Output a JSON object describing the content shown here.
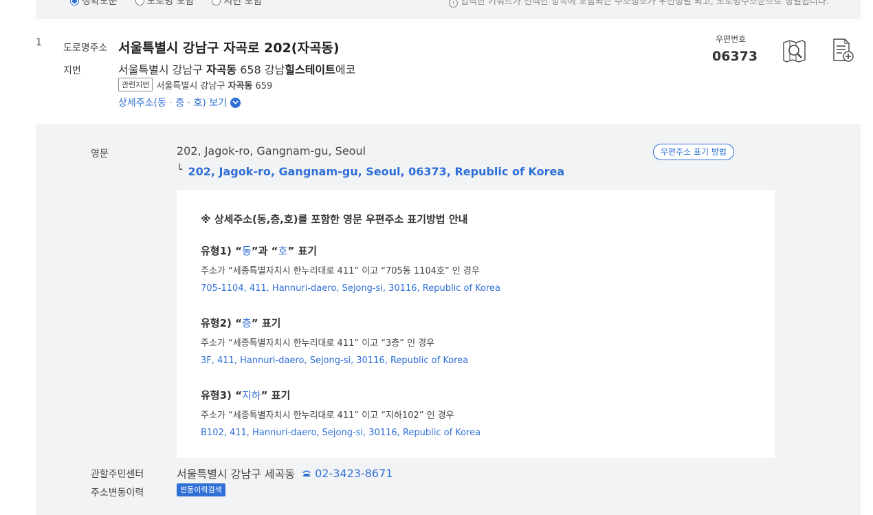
{
  "filter": {
    "options": [
      "정확도순",
      "도로명 포함",
      "지번 포함"
    ],
    "selected_index": 0,
    "hint": "입력한 키워드가 선택한 항목에 포함되는 주소정보가 우선정렬 되고, 도로명주소순으로 정렬됩니다."
  },
  "result": {
    "index": "1",
    "road_label": "도로명주소",
    "road_address": "서울특별시 강남구 자곡로 202(자곡동)",
    "jibun_label": "지번",
    "jibun_pre": "서울특별시 강남구 ",
    "jibun_bold1": "자곡동",
    "jibun_mid": " 658 강남",
    "jibun_bold2": "힐스테이트",
    "jibun_post": "에코",
    "related_tag": "관련지번",
    "related_pre": "서울특별시 강남구 ",
    "related_bold": "자곡동",
    "related_post": " 659",
    "detail_link": "상세주소(동 · 층 · 호) 보기",
    "postal_label": "우편번호",
    "postal_code": "06373"
  },
  "detail": {
    "english_label": "영문",
    "english_address": "202, Jagok-ro, Gangnam-gu, Seoul",
    "english_full": "202, Jagok-ro, Gangnam-gu, Seoul, 06373, Republic of Korea",
    "guide_button": "우편주소 표기 방법",
    "guide": {
      "title": "※ 상세주소(동,층,호)를 포함한 영문 우편주소 표기방법 안내",
      "types": [
        {
          "prefix": "유형1) “",
          "hl1": "동",
          "mid": "”과 “",
          "hl2": "호",
          "suffix": "” 표기",
          "desc": "주소가 “세종특별자치시 한누리대로 411” 이고 “705동 1104호” 인 경우",
          "example": "705-1104, 411, Hannuri-daero, Sejong-si, 30116, Republic of Korea"
        },
        {
          "prefix": "유형2) “",
          "hl1": "층",
          "suffix": "” 표기",
          "desc": "주소가 “세종특별자치시 한누리대로 411” 이고 “3층” 인 경우",
          "example": "3F, 411, Hannuri-daero, Sejong-si, 30116, Republic of Korea"
        },
        {
          "prefix": "유형3) “",
          "hl1": "지하",
          "suffix": "” 표기",
          "desc": "주소가 “세종특별자치시 한누리대로 411” 이고 “지하102” 인 경우",
          "example": "B102, 411, Hannuri-daero, Sejong-si, 30116, Republic of Korea"
        }
      ]
    },
    "center_label": "관할주민센터",
    "center_value": "서울특별시 강남구 세곡동",
    "center_phone": "02-3423-8671",
    "history_label": "주소변동이력",
    "history_button": "변동이력검색"
  },
  "colors": {
    "accent": "#2f6fd6",
    "panel_bg": "#f2f3f5"
  },
  "icons": [
    "map-icon",
    "document-add-icon",
    "chevron-down-icon",
    "phone-icon",
    "info-icon"
  ]
}
